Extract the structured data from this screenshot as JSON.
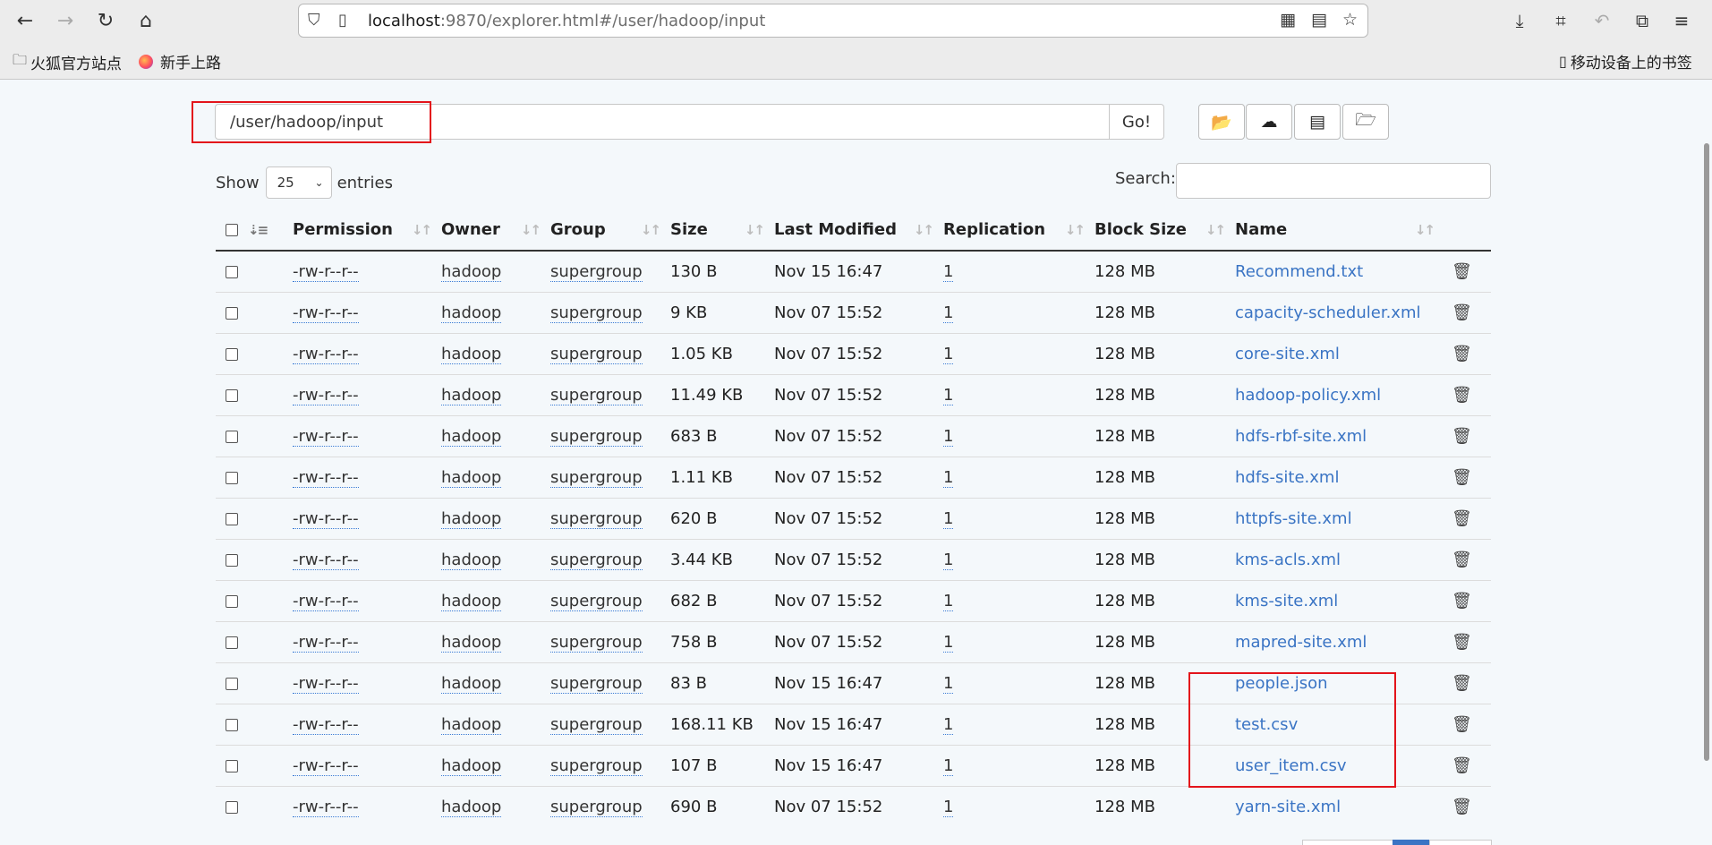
{
  "browser": {
    "url_host": "localhost",
    "url_rest": ":9870/explorer.html#/user/hadoop/input",
    "bookmarks": [
      "火狐官方站点",
      "新手上路"
    ],
    "mobile_bookmarks": "移动设备上的书签"
  },
  "explorer": {
    "path_value": "/user/hadoop/input",
    "go_label": "Go!",
    "show_label": "Show",
    "page_size": "25",
    "entries_label": "entries",
    "search_label": "Search:",
    "columns": [
      "Permission",
      "Owner",
      "Group",
      "Size",
      "Last Modified",
      "Replication",
      "Block Size",
      "Name"
    ],
    "rows": [
      {
        "permission": "-rw-r--r--",
        "owner": "hadoop",
        "group": "supergroup",
        "size": "130 B",
        "modified": "Nov 15 16:47",
        "replication": "1",
        "block_size": "128 MB",
        "name": "Recommend.txt"
      },
      {
        "permission": "-rw-r--r--",
        "owner": "hadoop",
        "group": "supergroup",
        "size": "9 KB",
        "modified": "Nov 07 15:52",
        "replication": "1",
        "block_size": "128 MB",
        "name": "capacity-scheduler.xml"
      },
      {
        "permission": "-rw-r--r--",
        "owner": "hadoop",
        "group": "supergroup",
        "size": "1.05 KB",
        "modified": "Nov 07 15:52",
        "replication": "1",
        "block_size": "128 MB",
        "name": "core-site.xml"
      },
      {
        "permission": "-rw-r--r--",
        "owner": "hadoop",
        "group": "supergroup",
        "size": "11.49 KB",
        "modified": "Nov 07 15:52",
        "replication": "1",
        "block_size": "128 MB",
        "name": "hadoop-policy.xml"
      },
      {
        "permission": "-rw-r--r--",
        "owner": "hadoop",
        "group": "supergroup",
        "size": "683 B",
        "modified": "Nov 07 15:52",
        "replication": "1",
        "block_size": "128 MB",
        "name": "hdfs-rbf-site.xml"
      },
      {
        "permission": "-rw-r--r--",
        "owner": "hadoop",
        "group": "supergroup",
        "size": "1.11 KB",
        "modified": "Nov 07 15:52",
        "replication": "1",
        "block_size": "128 MB",
        "name": "hdfs-site.xml"
      },
      {
        "permission": "-rw-r--r--",
        "owner": "hadoop",
        "group": "supergroup",
        "size": "620 B",
        "modified": "Nov 07 15:52",
        "replication": "1",
        "block_size": "128 MB",
        "name": "httpfs-site.xml"
      },
      {
        "permission": "-rw-r--r--",
        "owner": "hadoop",
        "group": "supergroup",
        "size": "3.44 KB",
        "modified": "Nov 07 15:52",
        "replication": "1",
        "block_size": "128 MB",
        "name": "kms-acls.xml"
      },
      {
        "permission": "-rw-r--r--",
        "owner": "hadoop",
        "group": "supergroup",
        "size": "682 B",
        "modified": "Nov 07 15:52",
        "replication": "1",
        "block_size": "128 MB",
        "name": "kms-site.xml"
      },
      {
        "permission": "-rw-r--r--",
        "owner": "hadoop",
        "group": "supergroup",
        "size": "758 B",
        "modified": "Nov 07 15:52",
        "replication": "1",
        "block_size": "128 MB",
        "name": "mapred-site.xml"
      },
      {
        "permission": "-rw-r--r--",
        "owner": "hadoop",
        "group": "supergroup",
        "size": "83 B",
        "modified": "Nov 15 16:47",
        "replication": "1",
        "block_size": "128 MB",
        "name": "people.json"
      },
      {
        "permission": "-rw-r--r--",
        "owner": "hadoop",
        "group": "supergroup",
        "size": "168.11 KB",
        "modified": "Nov 15 16:47",
        "replication": "1",
        "block_size": "128 MB",
        "name": "test.csv"
      },
      {
        "permission": "-rw-r--r--",
        "owner": "hadoop",
        "group": "supergroup",
        "size": "107 B",
        "modified": "Nov 15 16:47",
        "replication": "1",
        "block_size": "128 MB",
        "name": "user_item.csv"
      },
      {
        "permission": "-rw-r--r--",
        "owner": "hadoop",
        "group": "supergroup",
        "size": "690 B",
        "modified": "Nov 07 15:52",
        "replication": "1",
        "block_size": "128 MB",
        "name": "yarn-site.xml"
      }
    ]
  },
  "colors": {
    "link": "#3a74c4",
    "highlight": "#e3141b"
  }
}
